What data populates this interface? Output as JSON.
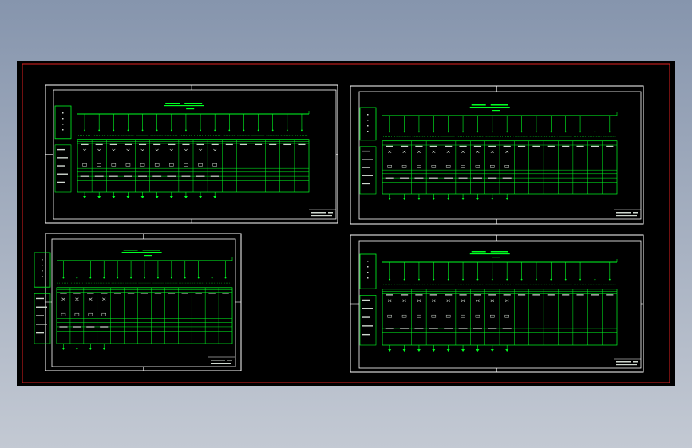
{
  "viewer": {
    "background_top": "#8695ad",
    "background_bottom": "#c3c9d3",
    "canvas_color": "#000000",
    "limits_color": "#e02020",
    "sheet_border_color": "#ffffff",
    "drawing_color": "#00ff22",
    "label_color": "#cfd8cf"
  },
  "sheets": [
    {
      "panels": 16,
      "loaded_feeders": 10,
      "legend_rows": 5
    },
    {
      "panels": 16,
      "loaded_feeders": 9,
      "legend_rows": 5
    },
    {
      "panels": 13,
      "loaded_feeders": 4,
      "legend_rows": 5
    },
    {
      "panels": 16,
      "loaded_feeders": 9,
      "legend_rows": 5
    }
  ]
}
